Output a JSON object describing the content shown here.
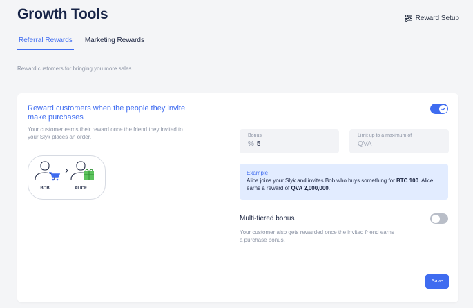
{
  "header": {
    "title": "Growth Tools",
    "setup_label": "Reward Setup"
  },
  "tabs": [
    {
      "label": "Referral Rewards",
      "active": true
    },
    {
      "label": "Marketing Rewards",
      "active": false
    }
  ],
  "intro_text": "Reward customers for bringing you more sales.",
  "card": {
    "heading": "Reward customers when the people they invite make purchases",
    "description": "Your customer earns their reward once the friend they invited to your Slyk places an order.",
    "toggle_on": true,
    "illustration": {
      "left_name": "BOB",
      "right_name": "ALICE"
    },
    "bonus_field": {
      "label": "Bonus",
      "prefix": "%",
      "value": "5"
    },
    "limit_field": {
      "label": "Limit up to a maximum of",
      "placeholder": "QVA"
    },
    "example": {
      "title": "Example",
      "line1": "Alice joins your Slyk and invites Bob who buys something for",
      "amount_bold": "BTC 100",
      "line2": ". Alice earns a reward of ",
      "reward_bold": "QVA 2,000,000",
      "end": "."
    },
    "multi_tier": {
      "title": "Multi-tiered bonus",
      "description": "Your customer also gets rewarded once the invited friend earns a purchase bonus.",
      "toggle_on": false
    },
    "save_label": "Save"
  },
  "colors": {
    "accent": "#3f6cf0",
    "example_bg": "#e2ecff",
    "cart_blue": "#3f6cf0",
    "gift_green": "#5cc35d"
  }
}
